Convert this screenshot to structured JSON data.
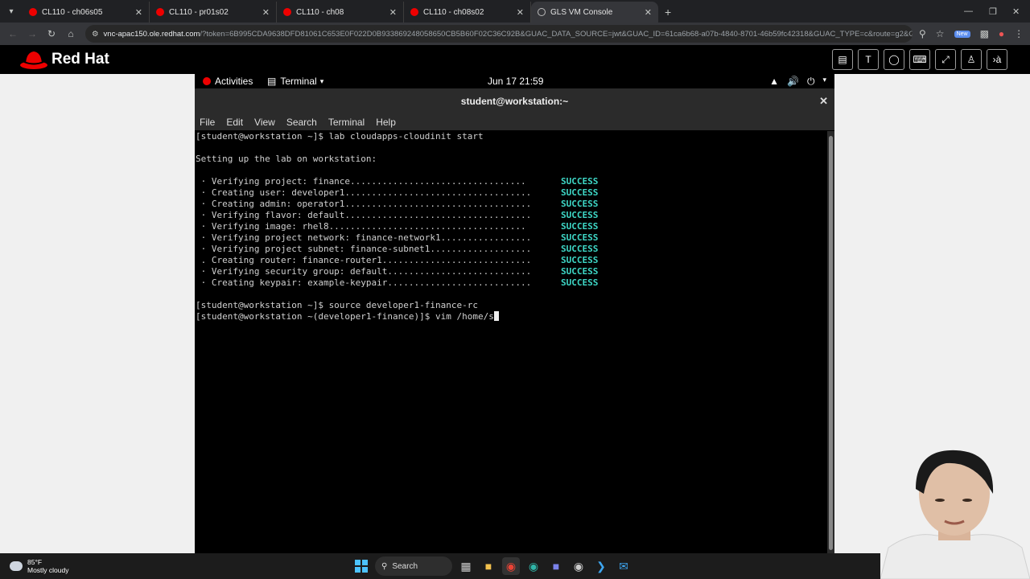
{
  "browser": {
    "tabs": [
      {
        "title": "CL110 - ch06s05",
        "active": false
      },
      {
        "title": "CL110 - pr01s02",
        "active": false
      },
      {
        "title": "CL110 - ch08",
        "active": false
      },
      {
        "title": "CL110 - ch08s02",
        "active": false
      },
      {
        "title": "GLS VM Console",
        "active": true
      }
    ],
    "url_host": "vnc-apac150.ole.redhat.com",
    "url_rest": "/?token=6B995CDA9638DFD81061C653E0F022D0B933869248058650CB5B60F02C36C92B&GUAC_DATA_SOURCE=jwt&GUAC_ID=61ca6b68-a07b-4840-8701-46b59fc42318&GUAC_TYPE=c&route=g2&GUAC_A...",
    "new_badge": "New"
  },
  "redhat": {
    "logo_text": "Red Hat",
    "tool_labels": [
      "T",
      "à"
    ]
  },
  "gnome": {
    "activities": "Activities",
    "app": "Terminal",
    "clock": "Jun 17  21:59"
  },
  "terminal": {
    "title": "student@workstation:~",
    "menu": [
      "File",
      "Edit",
      "View",
      "Search",
      "Terminal",
      "Help"
    ],
    "lines": [
      "[student@workstation ~]$ lab cloudapps-cloudinit start",
      "",
      "Setting up the lab on workstation:",
      "",
      " · Verifying project: finance.................................",
      " · Creating user: developer1...................................",
      " · Creating admin: operator1...................................",
      " · Verifying flavor: default...................................",
      " · Verifying image: rhel8.....................................",
      " · Verifying project network: finance-network1.................",
      " · Verifying project subnet: finance-subnet1...................",
      " . Creating router: finance-router1............................",
      " · Verifying security group: default...........................",
      " · Creating keypair: example-keypair...........................",
      "",
      "[student@workstation ~]$ source developer1-finance-rc",
      "[student@workstation ~(developer1-finance)]$ vim /home/s"
    ],
    "status_word": "SUCCESS",
    "status_rows": [
      4,
      5,
      6,
      7,
      8,
      9,
      10,
      11,
      12,
      13
    ]
  },
  "taskbar": {
    "temperature": "85°F",
    "weather": "Mostly cloudy",
    "search": "Search"
  },
  "colors": {
    "success": "#3ed8c7",
    "redhat_red": "#ee0000"
  }
}
